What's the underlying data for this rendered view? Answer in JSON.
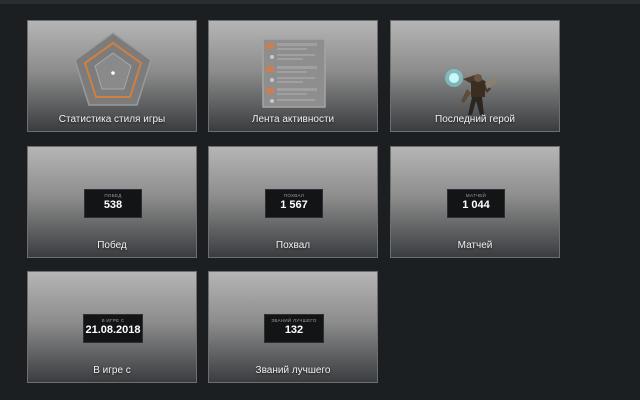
{
  "tiles": {
    "playstyle": {
      "label": "Статистика стиля игры"
    },
    "activity": {
      "label": "Лента активности"
    },
    "last_hero": {
      "label": "Последний герой"
    },
    "wins": {
      "label": "Побед",
      "caption": "Побед",
      "value": "538"
    },
    "commends": {
      "label": "Похвал",
      "caption": "Похвал",
      "value": "1 567"
    },
    "matches": {
      "label": "Матчей",
      "caption": "Матчей",
      "value": "1 044"
    },
    "since": {
      "label": "В игре с",
      "caption": "В игре с",
      "value": "21.08.2018"
    },
    "best_ranks": {
      "label": "Званий лучшего",
      "caption": "Званий лучшего",
      "value": "132"
    }
  },
  "icons": {
    "playstyle": "pentagon-radar-icon",
    "activity": "activity-feed-icon",
    "last_hero": "hero-figure-icon"
  },
  "colors": {
    "accent": "#d08040",
    "background": "#1c1f22",
    "stat_box": "#121416"
  }
}
